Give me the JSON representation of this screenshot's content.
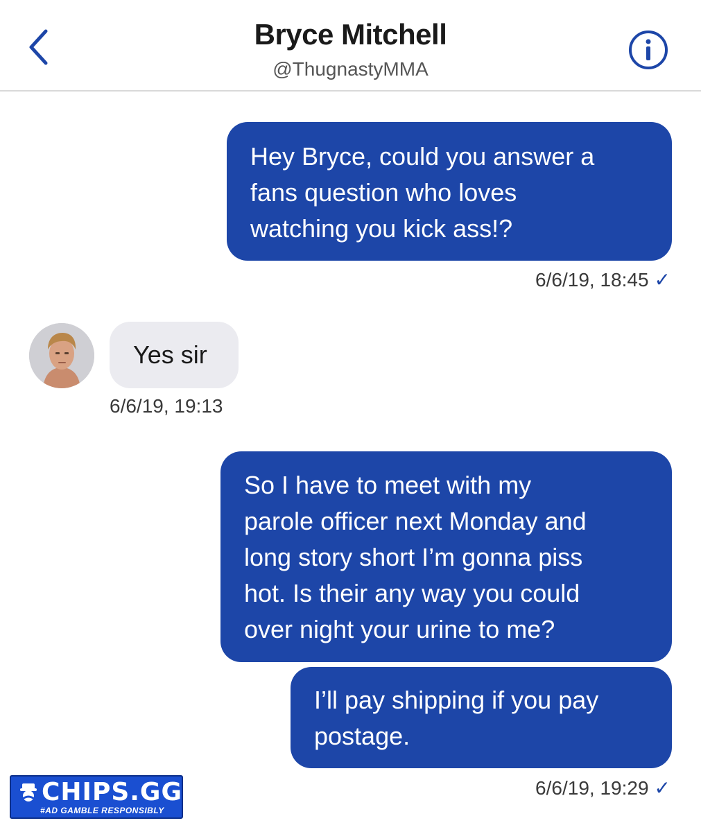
{
  "header": {
    "name": "Bryce Mitchell",
    "handle": "@ThugnastyMMA",
    "back_icon": "chevron-left-icon",
    "info_icon": "info-icon"
  },
  "messages": [
    {
      "direction": "sent",
      "lines": [
        "Hey Bryce, could you answer a",
        "fans question who loves",
        "watching you kick ass!?"
      ],
      "timestamp": "6/6/19, 18:45",
      "status": "✓"
    },
    {
      "direction": "received",
      "lines": [
        "Yes sir"
      ],
      "timestamp": "6/6/19, 19:13"
    },
    {
      "direction": "sent",
      "lines": [
        "So I have to meet with my",
        "parole officer next Monday and",
        "long story short I’m gonna piss",
        "hot. Is their any way you could",
        "over night your urine to me?"
      ]
    },
    {
      "direction": "sent",
      "lines": [
        "I’ll pay shipping if you pay",
        "postage."
      ],
      "timestamp": "6/6/19, 19:29",
      "status": "✓"
    }
  ],
  "watermark": {
    "brand": "CHIPS.GG",
    "tagline": "#AD GAMBLE RESPONSIBLY"
  },
  "colors": {
    "sent_bubble": "#1d46a8",
    "received_bubble": "#ebebf0",
    "accent": "#1d46a8"
  }
}
